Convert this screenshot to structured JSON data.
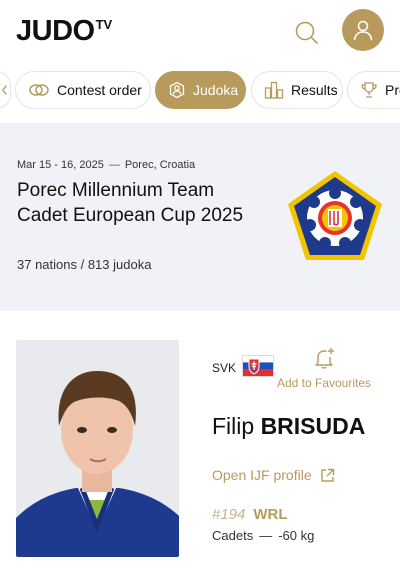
{
  "brand": {
    "name": "JUDO",
    "suffix": "TV"
  },
  "header": {
    "search_icon": "search-icon",
    "avatar_icon": "user-icon"
  },
  "tabs": [
    {
      "label": "",
      "icon": "chevron-icon"
    },
    {
      "label": "Contest order",
      "icon": "rings-icon"
    },
    {
      "label": "Judoka",
      "icon": "judoka-icon",
      "active": true
    },
    {
      "label": "Results",
      "icon": "bar-chart-icon"
    },
    {
      "label": "Pre",
      "icon": "trophy-icon"
    }
  ],
  "event": {
    "dates": "Mar 15 - 16, 2025",
    "dash": "—",
    "location": "Porec, Croatia",
    "title": "Porec Millennium Team Cadet European Cup 2025",
    "stats": "37 nations / 813 judoka"
  },
  "athlete": {
    "country_code": "SVK",
    "favourite_label": "Add to Favourites",
    "first_name": "Filip",
    "last_name": "BRISUDA",
    "ijf_link_label": "Open IJF profile",
    "rank_number": "#194",
    "rank_label": "WRL",
    "age_category": "Cadets",
    "dash": "—",
    "weight_category": "-60 kg"
  },
  "colors": {
    "accent": "#b89a5c",
    "event_bg": "#f1f2f7"
  }
}
